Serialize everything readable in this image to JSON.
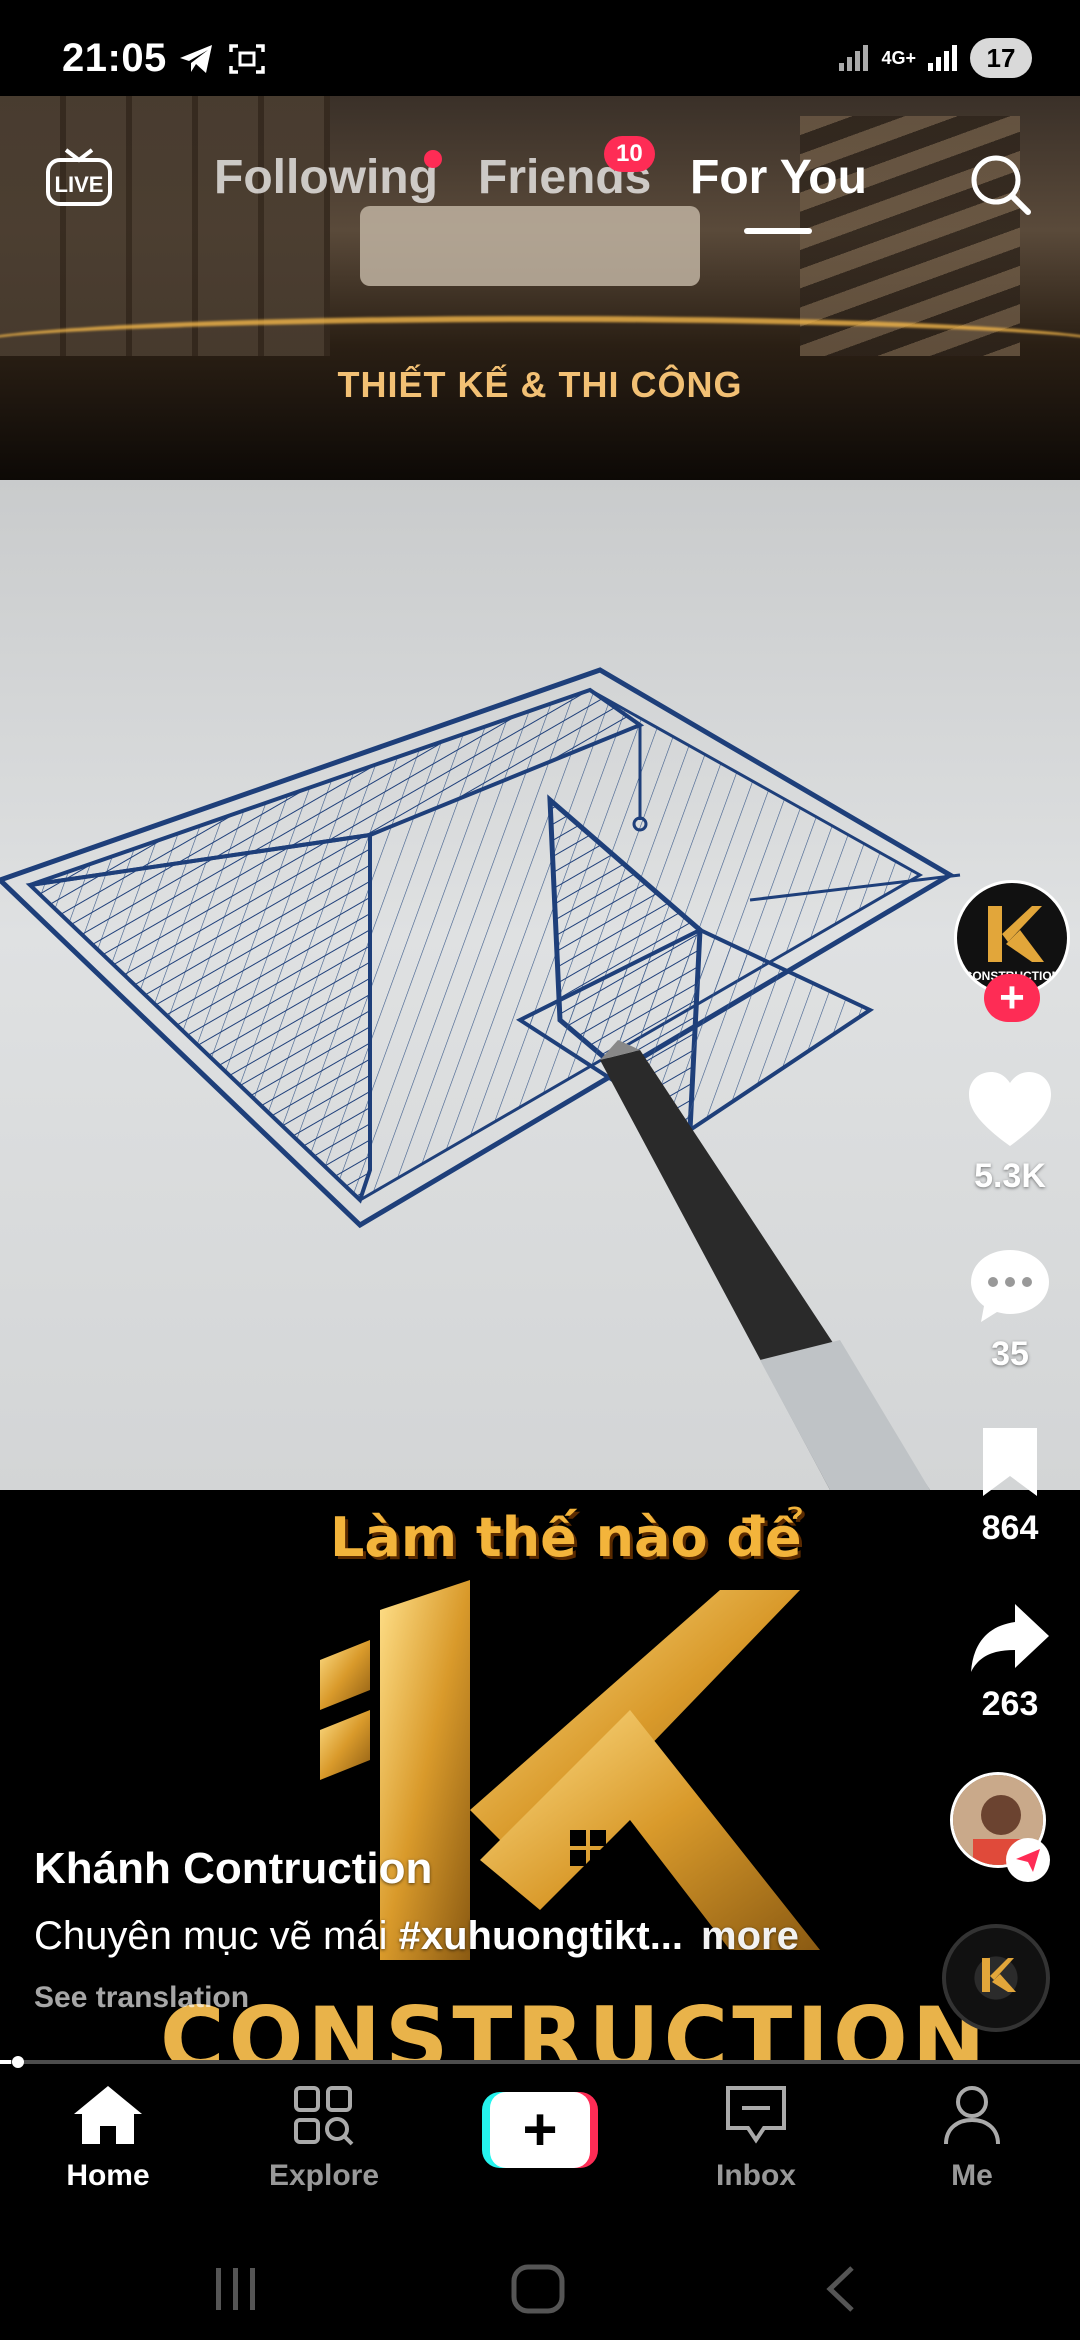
{
  "status_bar": {
    "time": "21:05",
    "network": "4G+",
    "battery": "17"
  },
  "banner": {
    "text": "THIẾT KẾ & THI CÔNG"
  },
  "top_nav": {
    "live_label": "LIVE",
    "tabs": [
      {
        "label": "Following",
        "has_dot": true
      },
      {
        "label": "Friends",
        "badge": "10"
      },
      {
        "label": "For You",
        "active": true
      }
    ],
    "search_icon": "search-icon"
  },
  "video": {
    "overlay_text": "Làm thế nào để",
    "logo_word": "CONSTRUCTION"
  },
  "actions": {
    "likes": "5.3K",
    "comments": "35",
    "saves": "864",
    "shares": "263"
  },
  "caption": {
    "author": "Khánh Contruction",
    "description_plain": "Chuyên mục vẽ mái ",
    "description_hashtag": "#xuhuongtikt...",
    "more_label": "more",
    "see_translation": "See translation"
  },
  "progress": {
    "fraction": 0.01
  },
  "bottom_nav": {
    "items": [
      {
        "label": "Home",
        "icon": "home-icon",
        "active": true
      },
      {
        "label": "Explore",
        "icon": "explore-icon"
      },
      {
        "label": "Inbox",
        "icon": "inbox-icon"
      },
      {
        "label": "Me",
        "icon": "profile-icon"
      }
    ],
    "create_label": "+"
  },
  "colors": {
    "accent": "#fe2c55",
    "cyan": "#25f4ee",
    "gold": "#f3b43b"
  }
}
